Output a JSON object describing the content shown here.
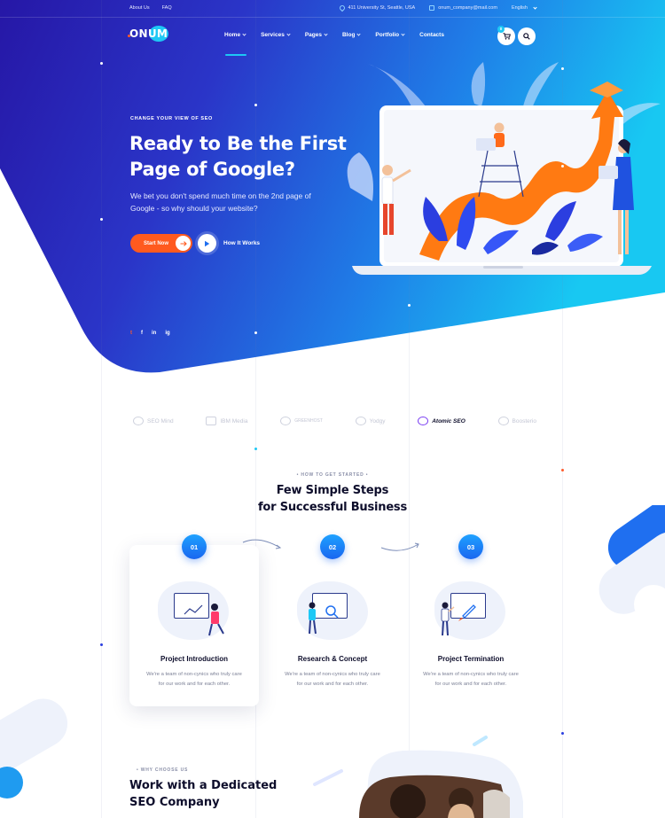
{
  "topbar": {
    "links": [
      "About Us",
      "FAQ"
    ],
    "address": "411 University St, Seattle, USA",
    "email": "onum_company@mail.com",
    "language": "English"
  },
  "brand": {
    "logo": "ONUM"
  },
  "nav": {
    "items": [
      "Home",
      "Services",
      "Pages",
      "Blog",
      "Portfolio",
      "Contacts"
    ],
    "cart_count": "0"
  },
  "hero": {
    "kicker": "CHANGE YOUR VIEW OF SEO",
    "title": "Ready to Be the First Page of Google?",
    "subtitle": "We bet you don't spend much time on the 2nd page of Google - so why should your website?",
    "start_label": "Start Now",
    "how_label": "How It Works",
    "social": [
      "t",
      "f",
      "in",
      "ig"
    ]
  },
  "brands": [
    "SEO Mind",
    "IBM Media",
    "GREENHOST",
    "Yodgy",
    "Atomic SEO",
    "Boosterio"
  ],
  "steps_section": {
    "kicker": "HOW TO GET STARTED",
    "title_line1": "Few Simple Steps",
    "title_line2": "for Successful Business",
    "steps": [
      {
        "num": "01",
        "title": "Project Introduction",
        "desc": "We're a team of non-cynics who truly care for our work and for each other."
      },
      {
        "num": "02",
        "title": "Research & Concept",
        "desc": "We're a team of non-cynics who truly care for our work and for each other."
      },
      {
        "num": "03",
        "title": "Project Termination",
        "desc": "We're a team of non-cynics who truly care for our work and for each other."
      }
    ]
  },
  "why_section": {
    "kicker": "WHY CHOOSE US",
    "title": "Work with a Dedicated SEO Company"
  },
  "colors": {
    "primary_blue": "#2a1aa8",
    "cyan": "#1ec8f5",
    "accent_orange": "#ff5a1f"
  }
}
